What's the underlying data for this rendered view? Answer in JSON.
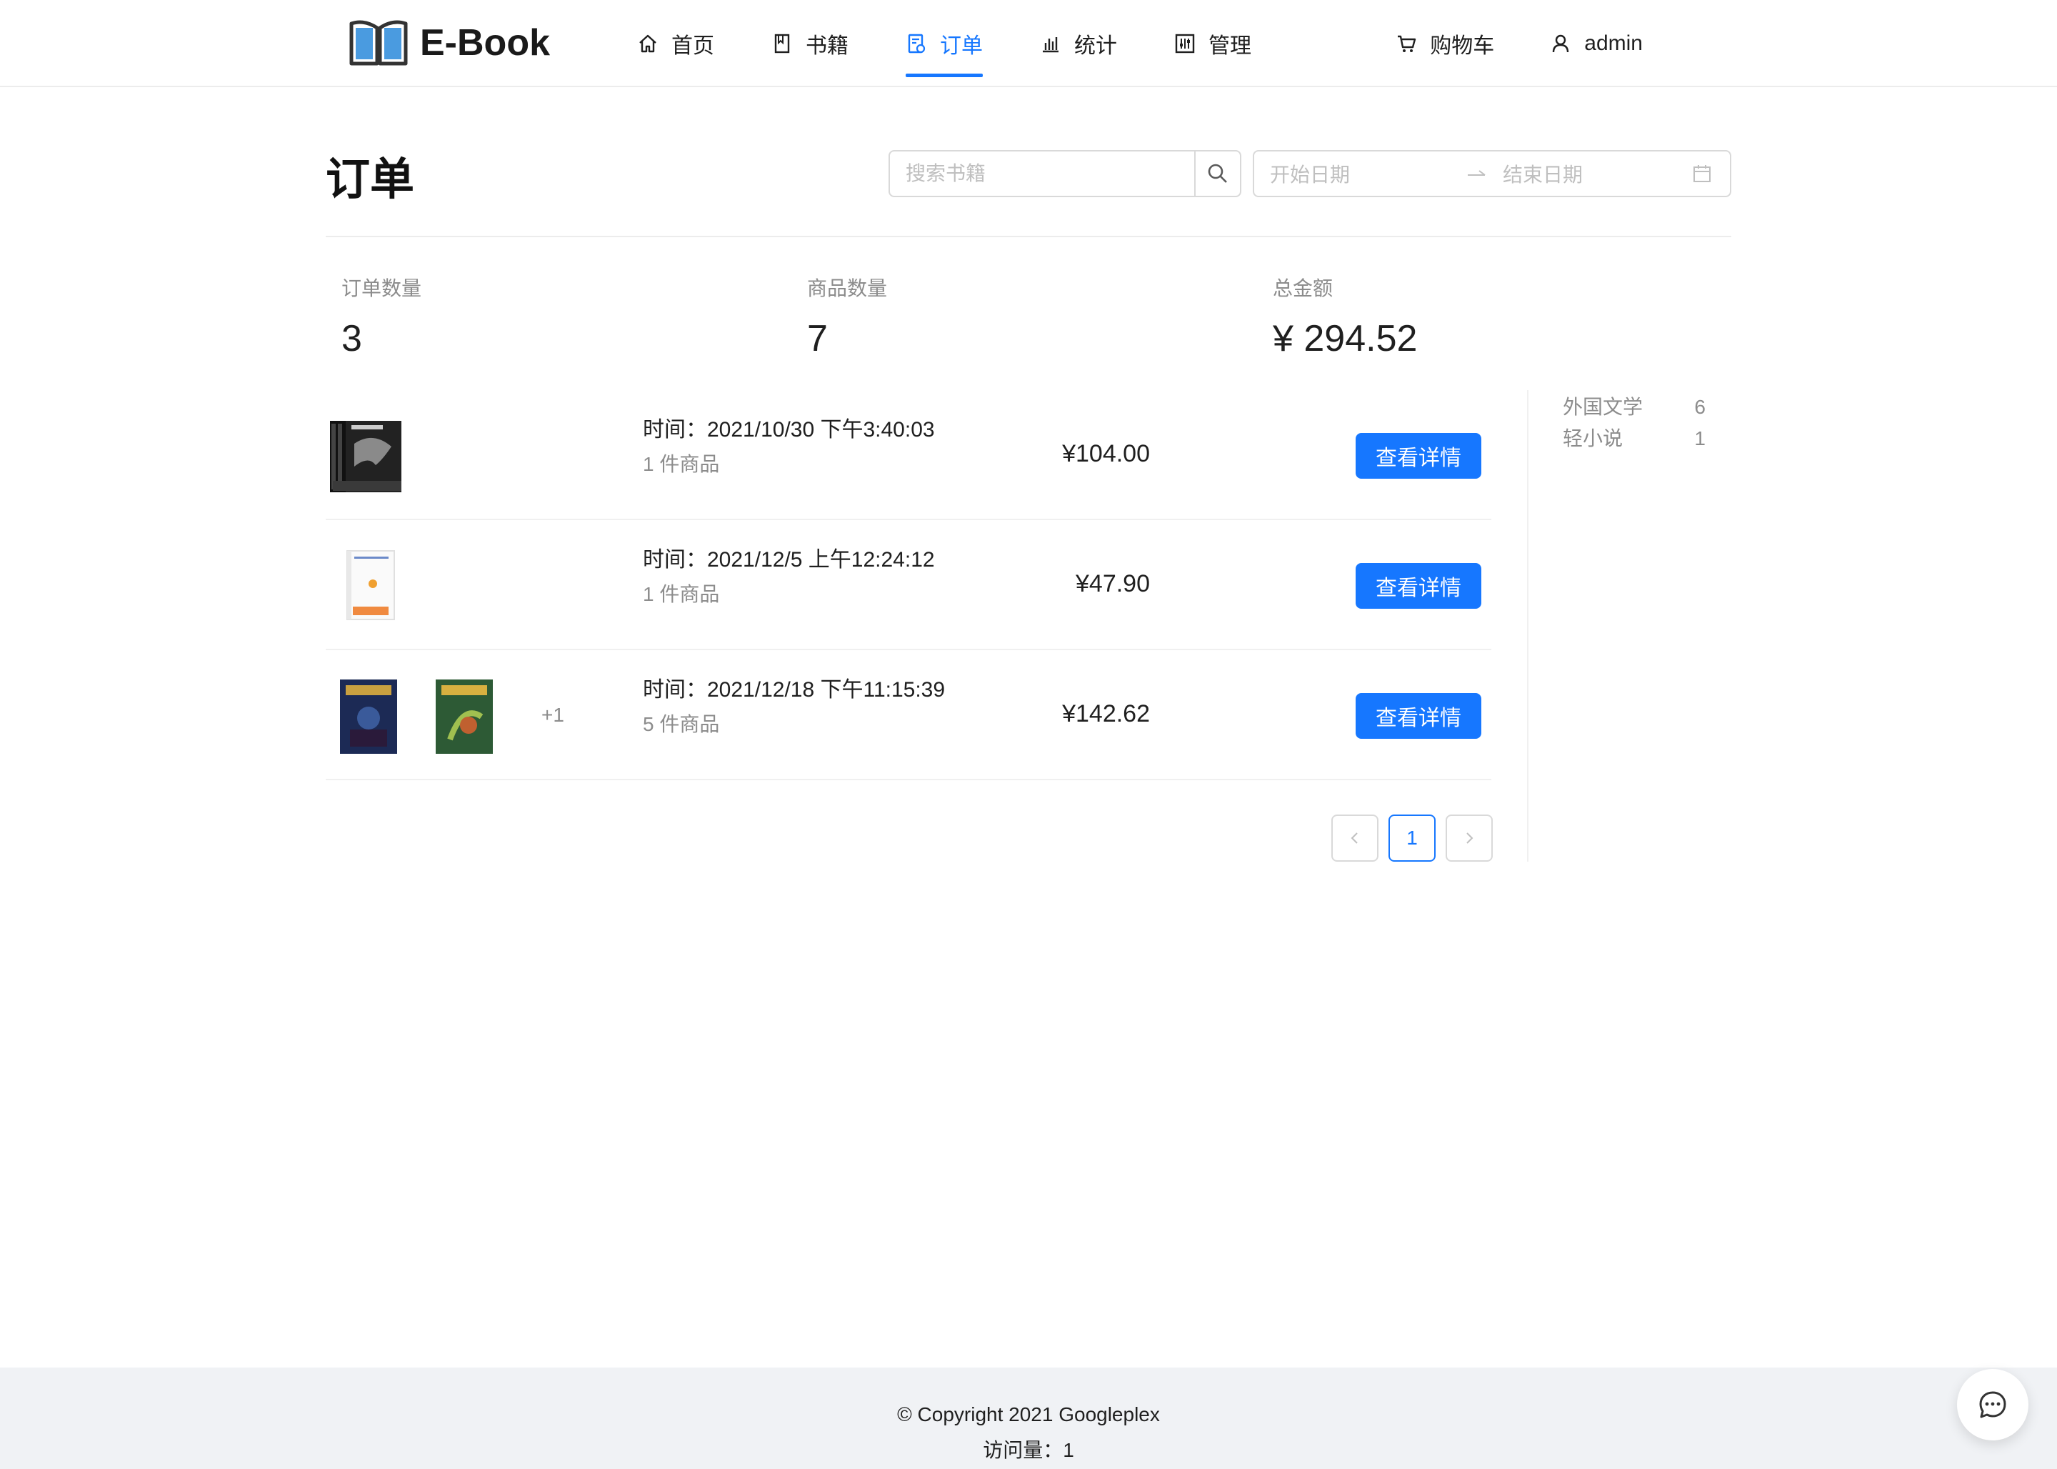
{
  "header": {
    "logo_text": "E-Book",
    "nav": [
      {
        "label": "首页",
        "icon": "home-icon"
      },
      {
        "label": "书籍",
        "icon": "book-icon"
      },
      {
        "label": "订单",
        "icon": "order-icon",
        "active": true
      },
      {
        "label": "统计",
        "icon": "chart-icon"
      },
      {
        "label": "管理",
        "icon": "settings-icon"
      }
    ],
    "cart_label": "购物车",
    "user_label": "admin"
  },
  "page": {
    "title": "订单",
    "search_placeholder": "搜索书籍",
    "date_start_placeholder": "开始日期",
    "date_end_placeholder": "结束日期"
  },
  "stats": {
    "order_count_label": "订单数量",
    "order_count": "3",
    "item_count_label": "商品数量",
    "item_count": "7",
    "total_label": "总金额",
    "total": "¥ 294.52"
  },
  "orders": [
    {
      "time": "时间：2021/10/30 下午3:40:03",
      "count": "1 件商品",
      "price": "¥104.00",
      "button": "查看详情",
      "more": ""
    },
    {
      "time": "时间：2021/12/5 上午12:24:12",
      "count": "1 件商品",
      "price": "¥47.90",
      "button": "查看详情",
      "more": ""
    },
    {
      "time": "时间：2021/12/18 下午11:15:39",
      "count": "5 件商品",
      "price": "¥142.62",
      "button": "查看详情",
      "more": "+1"
    }
  ],
  "pagination": {
    "current": "1"
  },
  "categories": [
    {
      "name": "外国文学",
      "count": "6"
    },
    {
      "name": "轻小说",
      "count": "1"
    }
  ],
  "footer": {
    "copyright": "© Copyright 2021 Googleplex",
    "visits": "访问量：1"
  },
  "colors": {
    "accent": "#1677ff",
    "footer_bg": "#f0f2f5"
  }
}
